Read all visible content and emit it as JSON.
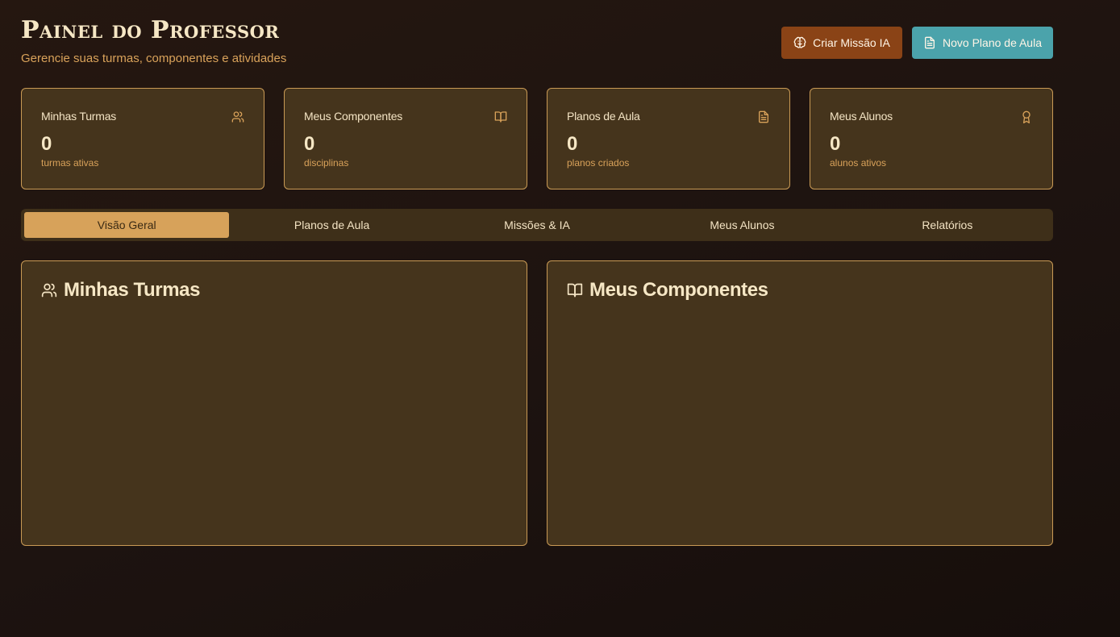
{
  "header": {
    "title": "Painel do Professor",
    "subtitle": "Gerencie suas turmas, componentes e atividades",
    "actions": {
      "mission_label": "Criar Missão IA",
      "plan_label": "Novo Plano de Aula"
    }
  },
  "stats": [
    {
      "label": "Minhas Turmas",
      "value": "0",
      "sub": "turmas ativas",
      "icon": "users-icon"
    },
    {
      "label": "Meus Componentes",
      "value": "0",
      "sub": "disciplinas",
      "icon": "book-open-icon"
    },
    {
      "label": "Planos de Aula",
      "value": "0",
      "sub": "planos criados",
      "icon": "file-text-icon"
    },
    {
      "label": "Meus Alunos",
      "value": "0",
      "sub": "alunos ativos",
      "icon": "award-icon"
    }
  ],
  "tabs": [
    {
      "label": "Visão Geral",
      "active": true
    },
    {
      "label": "Planos de Aula",
      "active": false
    },
    {
      "label": "Missões & IA",
      "active": false
    },
    {
      "label": "Meus Alunos",
      "active": false
    },
    {
      "label": "Relatórios",
      "active": false
    }
  ],
  "panels": {
    "turmas": {
      "title": "Minhas Turmas",
      "icon": "users-icon"
    },
    "componentes": {
      "title": "Meus Componentes",
      "icon": "book-open-icon"
    }
  },
  "colors": {
    "background": "#1d1310",
    "card": "#45341c",
    "card_border": "#c99a55",
    "accent": "#d7a25a",
    "mission_button": "#8a4316",
    "plan_button": "#4ba3ab"
  }
}
